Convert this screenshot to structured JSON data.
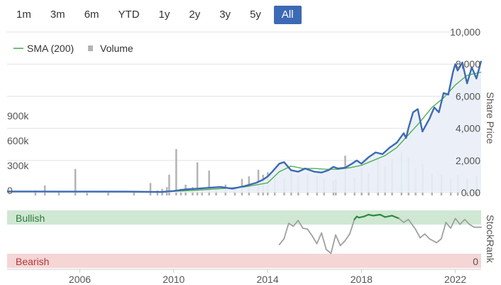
{
  "range_buttons": {
    "items": [
      {
        "label": "1m",
        "active": false
      },
      {
        "label": "3m",
        "active": false
      },
      {
        "label": "6m",
        "active": false
      },
      {
        "label": "YTD",
        "active": false
      },
      {
        "label": "1y",
        "active": false
      },
      {
        "label": "2y",
        "active": false
      },
      {
        "label": "3y",
        "active": false
      },
      {
        "label": "5y",
        "active": false
      },
      {
        "label": "All",
        "active": true
      }
    ]
  },
  "chart_data": [
    {
      "type": "line",
      "title": "",
      "legend": {
        "placement": "top-left",
        "entries": [
          "SMA (200)",
          "Volume"
        ]
      },
      "x_ticks": [
        "2006",
        "2010",
        "2014",
        "2018",
        "2022"
      ],
      "x_range": [
        2002.9,
        2023.1
      ],
      "price_axis": {
        "label": "Share Price",
        "ticks": [
          "10,000",
          "8,000",
          "6,000",
          "4,000",
          "2,000",
          "0.00"
        ],
        "range": [
          0,
          10000
        ]
      },
      "volume_axis": {
        "ticks": [
          "900k",
          "600k",
          "300k",
          "0"
        ],
        "range": [
          0,
          1200000
        ]
      },
      "grid": true,
      "colors": {
        "price": "#3d6ab4",
        "sma": "#4caf50",
        "volume": "#b3b3b3",
        "area": "#e9eef7"
      },
      "series": [
        {
          "name": "Price",
          "x": [
            2002.9,
            2004,
            2005,
            2006,
            2007,
            2008,
            2009,
            2009.5,
            2010,
            2010.5,
            2011,
            2011.5,
            2012,
            2012.5,
            2013,
            2013.5,
            2013.8,
            2014,
            2014.2,
            2014.5,
            2014.7,
            2015,
            2015.3,
            2015.6,
            2016,
            2016.3,
            2016.6,
            2016.8,
            2017,
            2017.3,
            2017.6,
            2017.8,
            2018,
            2018.3,
            2018.6,
            2018.9,
            2019.2,
            2019.5,
            2019.8,
            2019.9,
            2020,
            2020.2,
            2020.4,
            2020.6,
            2020.9,
            2021.1,
            2021.3,
            2021.5,
            2021.7,
            2021.9,
            2022,
            2022.1,
            2022.3,
            2022.5,
            2022.7,
            2022.9,
            2023.1
          ],
          "values": [
            70,
            70,
            60,
            60,
            60,
            60,
            50,
            40,
            100,
            200,
            250,
            300,
            350,
            250,
            400,
            600,
            800,
            1000,
            1300,
            1800,
            1900,
            1400,
            1300,
            1500,
            1300,
            1250,
            1400,
            1600,
            1500,
            1550,
            1800,
            2000,
            1800,
            2200,
            2500,
            2400,
            2800,
            3100,
            3700,
            3400,
            4000,
            5000,
            5200,
            3800,
            4600,
            5300,
            5000,
            6200,
            6100,
            7500,
            8000,
            7600,
            8100,
            6800,
            7800,
            7100,
            8200
          ]
        },
        {
          "name": "SMA (200)",
          "x": [
            2002.9,
            2005,
            2007,
            2009,
            2010,
            2011,
            2012,
            2013,
            2014,
            2014.5,
            2015,
            2015.5,
            2016,
            2016.5,
            2017,
            2017.5,
            2018,
            2018.5,
            2019,
            2019.5,
            2020,
            2020.5,
            2021,
            2021.5,
            2022,
            2022.5,
            2023.1
          ],
          "values": [
            60,
            60,
            50,
            50,
            80,
            150,
            250,
            350,
            600,
            1300,
            1650,
            1500,
            1500,
            1450,
            1450,
            1550,
            1700,
            2000,
            2300,
            2800,
            3600,
            4400,
            5300,
            5900,
            6700,
            7300,
            7500
          ]
        },
        {
          "name": "Volume",
          "type": "bar",
          "x": [
            2004.1,
            2004.5,
            2005.1,
            2005.8,
            2006.3,
            2007.2,
            2008.3,
            2009,
            2009.3,
            2009.5,
            2009.7,
            2009.8,
            2010.1,
            2010.3,
            2010.5,
            2010.8,
            2011,
            2011.2,
            2011.5,
            2011.8,
            2012.2,
            2012.6,
            2012.9,
            2013.2,
            2013.6,
            2013.8,
            2014,
            2014.3,
            2014.7,
            2015,
            2015.3,
            2015.7,
            2016.1,
            2016.4,
            2016.8,
            2016.9,
            2017.3,
            2017.7,
            2018,
            2018.3,
            2018.7,
            2019,
            2019.3,
            2019.7,
            2020,
            2020.3,
            2020.6,
            2021,
            2021.4,
            2021.8,
            2022.1,
            2022.5,
            2022.9
          ],
          "values": [
            60000,
            120000,
            40000,
            320000,
            30000,
            40000,
            40000,
            150000,
            60000,
            80000,
            100000,
            250000,
            560000,
            80000,
            130000,
            100000,
            400000,
            80000,
            300000,
            60000,
            130000,
            100000,
            200000,
            230000,
            310000,
            250000,
            280000,
            220000,
            200000,
            300000,
            230000,
            260000,
            230000,
            210000,
            180000,
            200000,
            480000,
            220000,
            330000,
            270000,
            440000,
            350000,
            440000,
            520000,
            460000,
            330000,
            380000,
            260000,
            250000,
            200000,
            250000,
            200000,
            230000
          ]
        }
      ]
    },
    {
      "type": "line",
      "title": "",
      "y_label": "StockRank",
      "bands": [
        {
          "label": "Bullish",
          "color": "#cfe8d3"
        },
        {
          "label": "Bearish",
          "color": "#f6d5d5"
        }
      ],
      "y_ticks": [
        "0"
      ],
      "y_range": [
        0,
        100
      ],
      "colors": {
        "neutral": "#a0a0a0",
        "bullish": "#2e8b3a"
      },
      "series": [
        {
          "name": "StockRank",
          "x": [
            2014.5,
            2014.7,
            2014.9,
            2015.1,
            2015.3,
            2015.5,
            2015.7,
            2015.9,
            2016.1,
            2016.3,
            2016.5,
            2016.7,
            2016.9,
            2017.1,
            2017.3,
            2017.5,
            2017.7,
            2017.8,
            2017.9,
            2018.1,
            2018.3,
            2018.5,
            2018.8,
            2019,
            2019.3,
            2019.6,
            2019.8,
            2020,
            2020.3,
            2020.5,
            2020.7,
            2020.9,
            2021.2,
            2021.4,
            2021.6,
            2021.8,
            2022,
            2022.2,
            2022.4,
            2022.6,
            2022.8,
            2023.1
          ],
          "values": [
            38,
            50,
            82,
            76,
            88,
            72,
            70,
            56,
            40,
            62,
            28,
            20,
            58,
            36,
            46,
            60,
            90,
            96,
            94,
            96,
            100,
            98,
            100,
            95,
            98,
            92,
            84,
            90,
            70,
            52,
            60,
            50,
            42,
            50,
            84,
            72,
            92,
            80,
            90,
            80,
            74,
            74
          ]
        }
      ]
    }
  ]
}
